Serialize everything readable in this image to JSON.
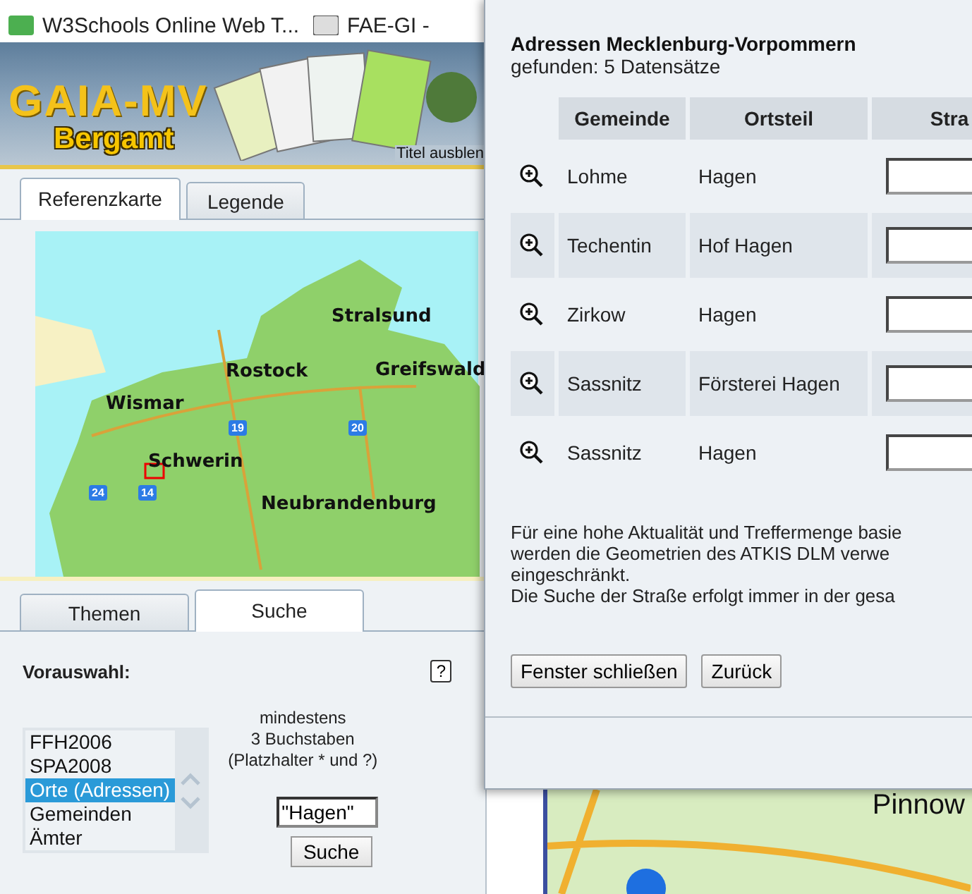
{
  "browser_bar": {
    "bookmarks": [
      {
        "label": "W3Schools Online Web T..."
      },
      {
        "label": "FAE-GI -"
      }
    ]
  },
  "banner": {
    "title": "GAIA-MV",
    "subtitle": "Bergamt",
    "toggle_link": "Titel ausblen"
  },
  "map_tabs": [
    {
      "label": "Referenzkarte",
      "selected": true
    },
    {
      "label": "Legende",
      "selected": false
    }
  ],
  "reference_map": {
    "cities": [
      {
        "name": "Stralsund"
      },
      {
        "name": "Rostock"
      },
      {
        "name": "Greifswald"
      },
      {
        "name": "Wismar"
      },
      {
        "name": "Schwerin"
      },
      {
        "name": "Neubrandenburg"
      }
    ],
    "roads": [
      {
        "number": "19"
      },
      {
        "number": "20"
      },
      {
        "number": "24"
      },
      {
        "number": "14"
      }
    ]
  },
  "panel_tabs": [
    {
      "label": "Themen",
      "selected": false
    },
    {
      "label": "Suche",
      "selected": true
    }
  ],
  "search": {
    "preselect_label": "Vorauswahl:",
    "help": "?",
    "options": [
      {
        "label": "FFH2006",
        "selected": false
      },
      {
        "label": "SPA2008",
        "selected": false
      },
      {
        "label": "Orte (Adressen)",
        "selected": true
      },
      {
        "label": "Gemeinden",
        "selected": false
      },
      {
        "label": "Ämter",
        "selected": false
      }
    ],
    "hint": "mindestens\n3 Buchstaben\n(Platzhalter * und ?)",
    "query": "\"Hagen\"",
    "button": "Suche"
  },
  "dialog": {
    "title": "Adressen Mecklenburg-Vorpommern",
    "count": "gefunden: 5 Datensätze",
    "columns": [
      "Gemeinde",
      "Ortsteil",
      "Stra"
    ],
    "rows": [
      {
        "gemeinde": "Lohme",
        "ortsteil": "Hagen"
      },
      {
        "gemeinde": "Techentin",
        "ortsteil": "Hof Hagen"
      },
      {
        "gemeinde": "Zirkow",
        "ortsteil": "Hagen"
      },
      {
        "gemeinde": "Sassnitz",
        "ortsteil": "Försterei Hagen"
      },
      {
        "gemeinde": "Sassnitz",
        "ortsteil": "Hagen"
      }
    ],
    "note_lines": [
      "Für eine hohe Aktualität und Treffermenge basie",
      "werden die Geometrien des ATKIS DLM verwe",
      "eingeschränkt.",
      "Die Suche der Straße erfolgt immer in der gesa"
    ],
    "buttons": [
      "Fenster schließen",
      "Zurück"
    ]
  },
  "background_map": {
    "label": "Pinnow"
  }
}
